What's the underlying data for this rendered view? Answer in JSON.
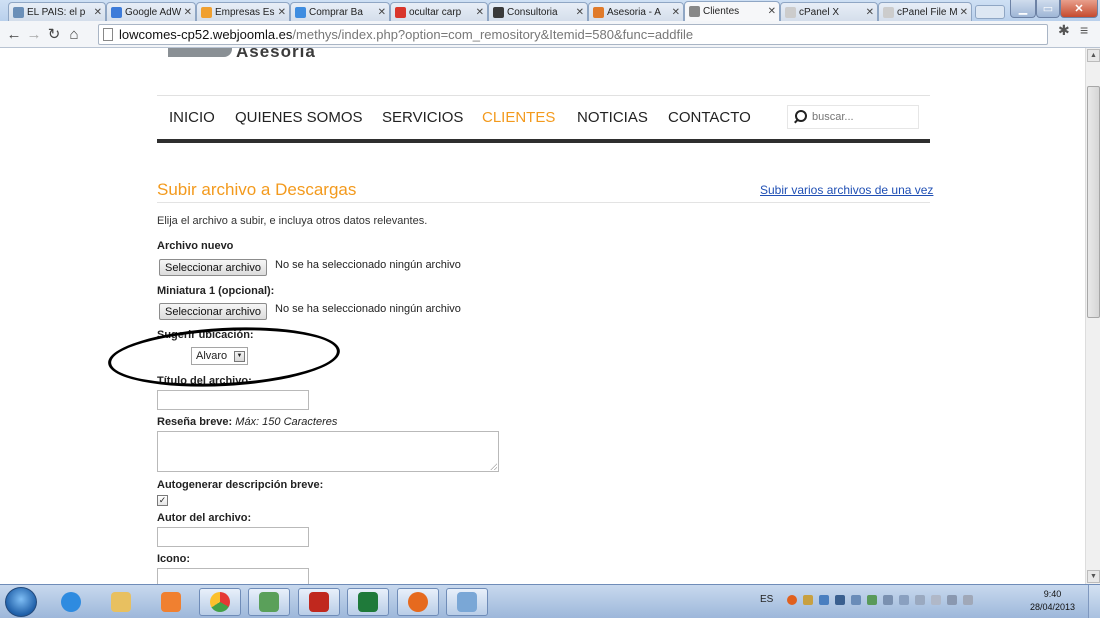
{
  "browser": {
    "tabs": [
      {
        "title": "EL PAÍS: el p",
        "color": "#6b8fb8"
      },
      {
        "title": "Google AdW",
        "color": "#3d7bd9"
      },
      {
        "title": "Empresas Es",
        "color": "#f0a030"
      },
      {
        "title": "Comprar Ba",
        "color": "#3f8de0"
      },
      {
        "title": "ocultar carp",
        "color": "#d9352b"
      },
      {
        "title": "Consultoria",
        "color": "#3a3a3a"
      },
      {
        "title": "Asesoria - A",
        "color": "#e07a2a"
      },
      {
        "title": "Clientes",
        "color": "#888888",
        "active": true
      },
      {
        "title": "cPanel X",
        "color": "#cccccc"
      },
      {
        "title": "cPanel File M",
        "color": "#cccccc"
      }
    ],
    "url_host": "lowcomes-cp52.webjoomla.es",
    "url_path": "/methys/index.php?option=com_remository&Itemid=580&func=addfile"
  },
  "site": {
    "logo_text": "Asesoria",
    "nav": {
      "items": [
        "INICIO",
        "QUIENES SOMOS",
        "SERVICIOS",
        "CLIENTES",
        "NOTICIAS",
        "CONTACTO"
      ],
      "active": "CLIENTES",
      "search_placeholder": "buscar..."
    }
  },
  "form": {
    "heading": "Subir archivo a Descargas",
    "multi_link": "Subir varios archivos de una vez",
    "intro": "Elija el archivo a subir, e incluya otros datos relevantes.",
    "file_new_label": "Archivo nuevo",
    "select_button": "Seleccionar archivo",
    "no_file": "No se ha seleccionado ningún archivo",
    "thumb_label": "Miniatura 1 (opcional):",
    "suggest_label": "Sugerir ubicación:",
    "location_value": "Alvaro",
    "title_label": "Título del archivo:",
    "summary_label": "Reseña breve:",
    "summary_note": "Máx: 150 Caracteres",
    "autogen_label": "Autogenerar descripción breve:",
    "autogen_checked": true,
    "author_label": "Autor del archivo:",
    "icon_label": "Icono:"
  },
  "taskbar": {
    "lang": "ES",
    "time": "9:40",
    "date": "28/04/2013"
  }
}
